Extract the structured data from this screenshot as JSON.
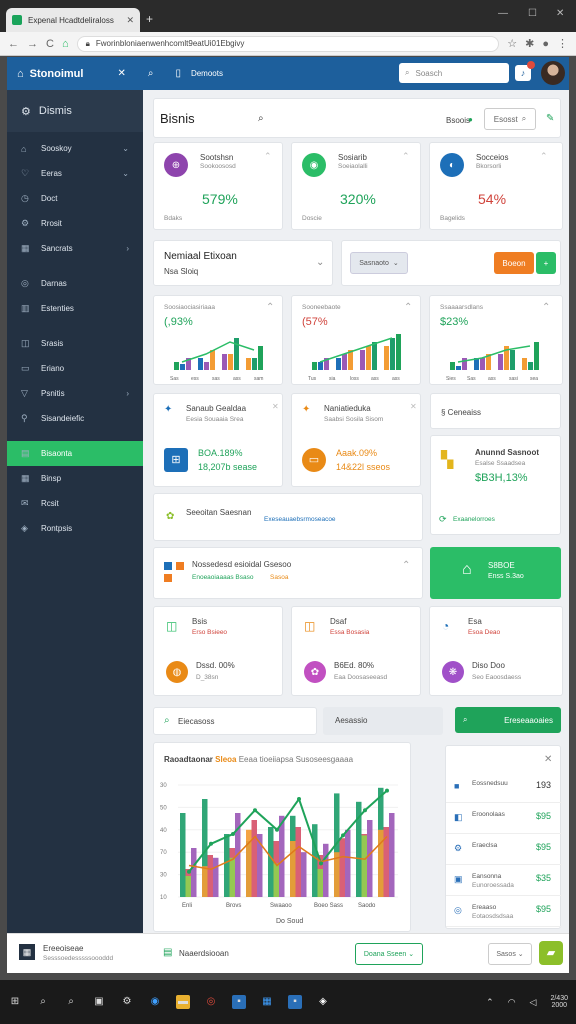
{
  "browser": {
    "tab_title": "Expenal Hcadtdeliraloss",
    "url": "Fworinbloniaenwenhcomlt9eatUi01Ebgivy",
    "nav": [
      "←",
      "→",
      "C",
      "⌂"
    ]
  },
  "app": {
    "title": "Stonoimul",
    "search_placeholder": "Soasch",
    "filter_label": "Demoots"
  },
  "sidebar": {
    "title": "Dismis",
    "items": [
      {
        "label": "Sooskoy",
        "icon": "home-icon",
        "chev": "⌄"
      },
      {
        "label": "Eeras",
        "icon": "heart-icon",
        "chev": "⌄"
      },
      {
        "label": "Doct",
        "icon": "clock-icon",
        "chev": ""
      },
      {
        "label": "Rrosit",
        "icon": "gear-icon",
        "chev": ""
      },
      {
        "label": "Sancrats",
        "icon": "grid-icon",
        "chev": "›"
      },
      {
        "label": "Darnas",
        "icon": "target-icon",
        "chev": ""
      },
      {
        "label": "Estenties",
        "icon": "chart-icon",
        "chev": ""
      },
      {
        "label": "Srasis",
        "icon": "bag-icon",
        "chev": ""
      },
      {
        "label": "Eriano",
        "icon": "box-icon",
        "chev": ""
      },
      {
        "label": "Psnitis",
        "icon": "triangle-icon",
        "chev": "›"
      },
      {
        "label": "Sisandeiefic",
        "icon": "pin-icon",
        "chev": ""
      },
      {
        "label": "Bisaonta",
        "icon": "ticket-icon",
        "chev": "",
        "active": true
      },
      {
        "label": "Binsp",
        "icon": "calendar-icon",
        "chev": ""
      },
      {
        "label": "Rcsit",
        "icon": "mail-icon",
        "chev": ""
      },
      {
        "label": "Rontpsis",
        "icon": "layers-icon",
        "chev": ""
      }
    ]
  },
  "header": {
    "title": "Bisnis",
    "action1": "Bsoois",
    "search": "Esosst"
  },
  "kpis": [
    {
      "title": "Sootshsn",
      "sub": "Sookoososd",
      "value": "579%",
      "foot": "Bdaks",
      "color": "#8e44ad",
      "valclass": "green",
      "glyph": "⊕"
    },
    {
      "title": "Sosiarib",
      "sub": "Soeiaolalli",
      "value": "320%",
      "foot": "Doscie",
      "color": "#2bbd67",
      "valclass": "green",
      "glyph": "◉"
    },
    {
      "title": "Socceios",
      "sub": "Bkorsorli",
      "value": "54%",
      "foot": "Bagelids",
      "color": "#1d6fb8",
      "valclass": "red",
      "glyph": "◐"
    }
  ],
  "filter": {
    "title": "Nemiaal Etixoan",
    "sub": "Nsa Sloiq",
    "select": "Sasnaoto",
    "orange_btn": "Boeon",
    "green_btn": "+"
  },
  "mini_charts": [
    {
      "title": "Soosiaociasiriaaa",
      "value": "(,93%",
      "valclass": "green",
      "xt": [
        "Sas",
        "ess",
        "sas",
        "ass",
        "sam"
      ],
      "bars": [
        [
          2,
          1.5,
          3
        ],
        [
          3,
          2,
          5
        ],
        [
          4,
          4,
          8
        ],
        [
          3,
          3,
          6
        ]
      ]
    },
    {
      "title": "Sooneebaote",
      "value": "(57%",
      "valclass": "red",
      "xt": [
        "Tus",
        "sia",
        "loss",
        "ass",
        "ass"
      ],
      "bars": [
        [
          2,
          2,
          3
        ],
        [
          3,
          4,
          5
        ],
        [
          5,
          6,
          7
        ],
        [
          6,
          8,
          9
        ]
      ]
    },
    {
      "title": "Ssaaaarsdlans",
      "value": "$23%",
      "valclass": "green",
      "xt": [
        "Sies",
        "Sas",
        "ass",
        "sasi",
        "sea"
      ],
      "bars": [
        [
          2,
          1,
          3
        ],
        [
          3,
          3,
          4
        ],
        [
          4,
          6,
          5
        ],
        [
          3,
          2,
          7
        ]
      ]
    }
  ],
  "mid_cards": [
    {
      "title": "Sanaub Gealdaa",
      "sub": "Eesia Souaaia Srea",
      "value": "BOA.189%",
      "value2": "18,207b sease",
      "color": "#1d6fb8",
      "valclass": "green",
      "glyph": "⊞"
    },
    {
      "title": "Naniatieduka",
      "sub": "Saabsi Sosila Sisom",
      "value": "Aaak.09%",
      "value2": "14&22l sseos",
      "color": "#e98a16",
      "valclass": "orange",
      "glyph": "▭"
    }
  ],
  "right_panel": {
    "head": "Ceneaiss",
    "title": "Anunnd Sasnoot",
    "sub": "Esalse Ssaadsea",
    "value": "$B3H,13%",
    "link": "Exaanelorroes"
  },
  "notice": {
    "title": "Seeoitan Saesnan",
    "link": "Exeseauaebsrmoseacoe"
  },
  "mid_row": {
    "title": "Nossedesd esioidal Gsesoo",
    "sub": "Enoeaoiaaaas Bsaso",
    "link": "Sasoa"
  },
  "green_card": {
    "title": "S8BOE",
    "sub": "Enss S.3ao"
  },
  "small_cards": [
    {
      "title": "Bsis",
      "sub": "Erso Bsieeo",
      "value": "Dssd. 00%",
      "value2": "D_38sn",
      "color": "#2bbd67",
      "circle": "#e98a16",
      "glyph": "◫",
      "cglyph": "◍",
      "subclass": "red"
    },
    {
      "title": "Dsaf",
      "sub": "Essa Bosasia",
      "value": "B6Ed. 80%",
      "value2": "Eaa Doosaseeasd",
      "color": "#e98a16",
      "circle": "#c150c1",
      "glyph": "◫",
      "cglyph": "✿",
      "subclass": "red"
    },
    {
      "title": "Esa",
      "sub": "Esoa Deao",
      "value": "Diso Doo",
      "value2": "Seo Eaoosdaess",
      "color": "#1d6fb8",
      "circle": "#a050c8",
      "glyph": "◔",
      "cglyph": "❋",
      "subclass": "red"
    }
  ],
  "toolbar": {
    "search": "Eiecasoss",
    "label": "Aesassio",
    "green_btn": "Ereseaaoaies",
    "green_ic": "⌕"
  },
  "bigchart_header": {
    "title": "Raoadtaonar",
    "mid": "Sleoa",
    "rest": "Eeaa tioeiiapsa Susoseesgaaaa"
  },
  "chart_data": {
    "type": "bar",
    "title": "Raoadtaonar Sleoa Eeaa tioeiiapsa Susoseesgaaaa",
    "xlabel": "Do Soud",
    "ylabel": "",
    "y_ticks": [
      "30",
      "50",
      "40",
      "70",
      "30",
      "10"
    ],
    "categories": [
      "Enli",
      "Brovs",
      "Swaaoo",
      "Boeo Sass",
      "Saodo"
    ],
    "series": [
      {
        "color": "#1e9e6b",
        "values": [
          60,
          70,
          45,
          40,
          50,
          58,
          52,
          74,
          68,
          78
        ]
      },
      {
        "color": "#d6536a",
        "values": [
          20,
          30,
          35,
          55,
          40,
          50,
          30,
          42,
          45,
          50
        ]
      },
      {
        "color": "#9b59b6",
        "values": [
          35,
          28,
          60,
          45,
          58,
          32,
          38,
          48,
          55,
          60
        ]
      },
      {
        "color": "#f39c34",
        "values": [
          25,
          22,
          30,
          48,
          25,
          40,
          28,
          32,
          30,
          48
        ]
      },
      {
        "color": "#8fd14f",
        "values": [
          15,
          38,
          28,
          60,
          24,
          56,
          20,
          34,
          44,
          38
        ]
      }
    ],
    "line": [
      18,
      38,
      45,
      62,
      48,
      70,
      24,
      44,
      62,
      76
    ]
  },
  "list_panel": {
    "items": [
      {
        "label": "Eossnedsuu",
        "value": "193",
        "vclass": "",
        "icon": "■"
      },
      {
        "label": "Eroonolaas",
        "value": "$95",
        "vclass": "green",
        "icon": "◧"
      },
      {
        "label": "Eraeclsa",
        "value": "$95",
        "vclass": "green",
        "icon": "⚙"
      },
      {
        "label": "Eansonna",
        "value": "$35",
        "vclass": "green",
        "icon": "▣"
      },
      {
        "label": "Ereaaso",
        "value": "$95",
        "vclass": "green",
        "icon": "◎"
      }
    ],
    "item_subs": [
      "",
      "",
      "",
      "Eunoroessada",
      "Eotaosdsdsaa"
    ]
  },
  "footer": {
    "left_title": "Ereeoiseae",
    "left_sub": "Sesssoedesssssoooddd",
    "mid": "Naaerdsiooan",
    "btn1": "Doana Sseen ⌄",
    "btn2": "Sasos ⌄"
  },
  "taskbar": {
    "time": "2/430",
    "date": "2000"
  }
}
